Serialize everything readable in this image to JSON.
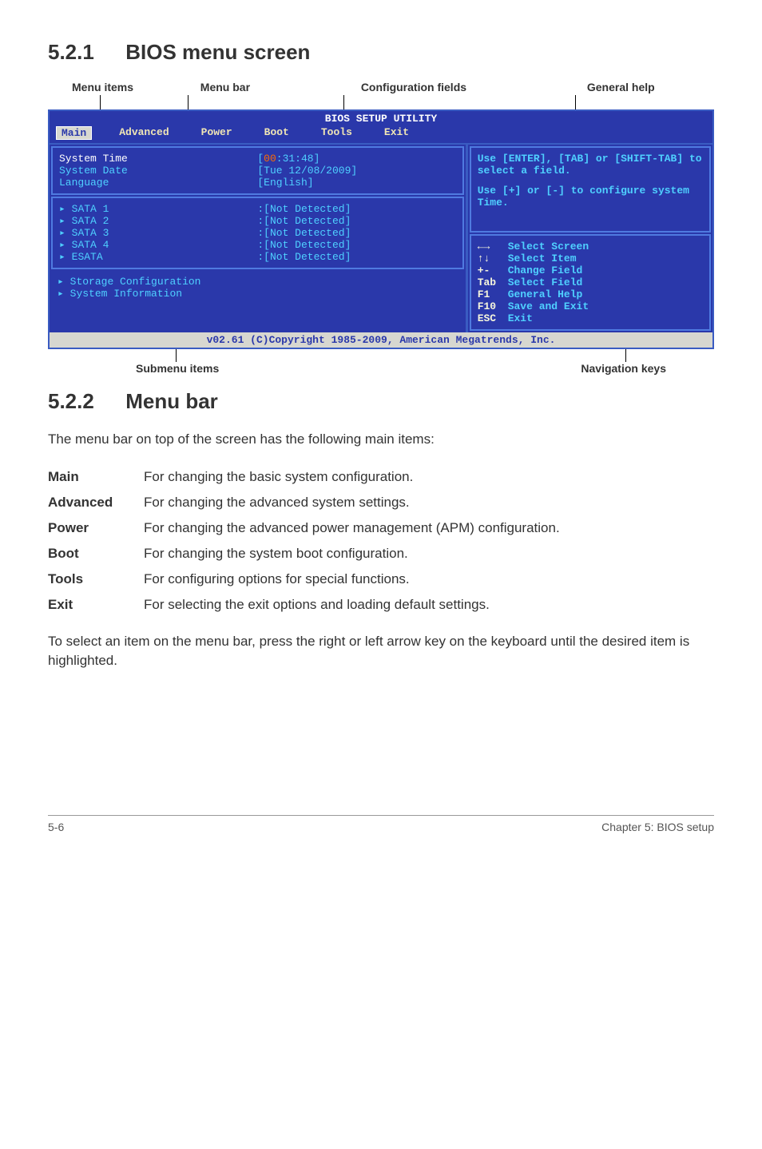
{
  "sections": {
    "s1": {
      "num": "5.2.1",
      "title": "BIOS menu screen"
    },
    "s2": {
      "num": "5.2.2",
      "title": "Menu bar"
    }
  },
  "labels": {
    "menu_items": "Menu items",
    "menu_bar": "Menu bar",
    "config_fields": "Configuration fields",
    "general_help": "General help",
    "submenu_items": "Submenu items",
    "nav_keys": "Navigation keys"
  },
  "bios": {
    "title": "BIOS SETUP UTILITY",
    "tabs": [
      "Main",
      "Advanced",
      "Power",
      "Boot",
      "Tools",
      "Exit"
    ],
    "left_group1": {
      "system_time_label": "System Time",
      "system_time_val_pre": "[",
      "system_time_hh": "00",
      "system_time_rest": ":31:48]",
      "system_date_label": "System Date",
      "system_date_val": "[Tue 12/08/2009]",
      "language_label": "Language",
      "language_val": "[English]"
    },
    "left_group2": {
      "sata1": "SATA 1",
      "sata1_val": ":[Not Detected]",
      "sata2": "SATA 2",
      "sata2_val": ":[Not Detected]",
      "sata3": "SATA 3",
      "sata3_val": ":[Not Detected]",
      "sata4": "SATA 4",
      "sata4_val": ":[Not Detected]",
      "esata": "ESATA",
      "esata_val": ":[Not Detected]"
    },
    "left_plain": {
      "storage": "Storage Configuration",
      "sysinfo": "System Information"
    },
    "right_help1": "Use [ENTER], [TAB] or [SHIFT-TAB] to select a field.",
    "right_help2": "Use [+] or [-] to configure system Time.",
    "nav": {
      "k1": "←→",
      "d1": "Select Screen",
      "k2": "↑↓",
      "d2": "Select Item",
      "k3": "+-",
      "d3": "Change Field",
      "k4": "Tab",
      "d4": "Select Field",
      "k5": "F1",
      "d5": "General Help",
      "k6": "F10",
      "d6": "Save and Exit",
      "k7": "ESC",
      "d7": "Exit"
    },
    "footer": "v02.61 (C)Copyright 1985-2009, American Megatrends, Inc."
  },
  "menubar_intro": "The menu bar on top of the screen has the following main items:",
  "defs": {
    "main_t": "Main",
    "main_d": "For changing the basic system configuration.",
    "adv_t": "Advanced",
    "adv_d": "For changing the advanced system settings.",
    "pwr_t": "Power",
    "pwr_d": "For changing the advanced power management (APM) configuration.",
    "boot_t": "Boot",
    "boot_d": "For changing the system boot configuration.",
    "tools_t": "Tools",
    "tools_d": "For configuring options for special functions.",
    "exit_t": "Exit",
    "exit_d": "For selecting the exit options and loading default settings."
  },
  "closing": "To select an item on the menu bar, press the right or left arrow key on the keyboard until the desired item is highlighted.",
  "footer": {
    "page": "5-6",
    "chapter": "Chapter 5: BIOS setup"
  }
}
